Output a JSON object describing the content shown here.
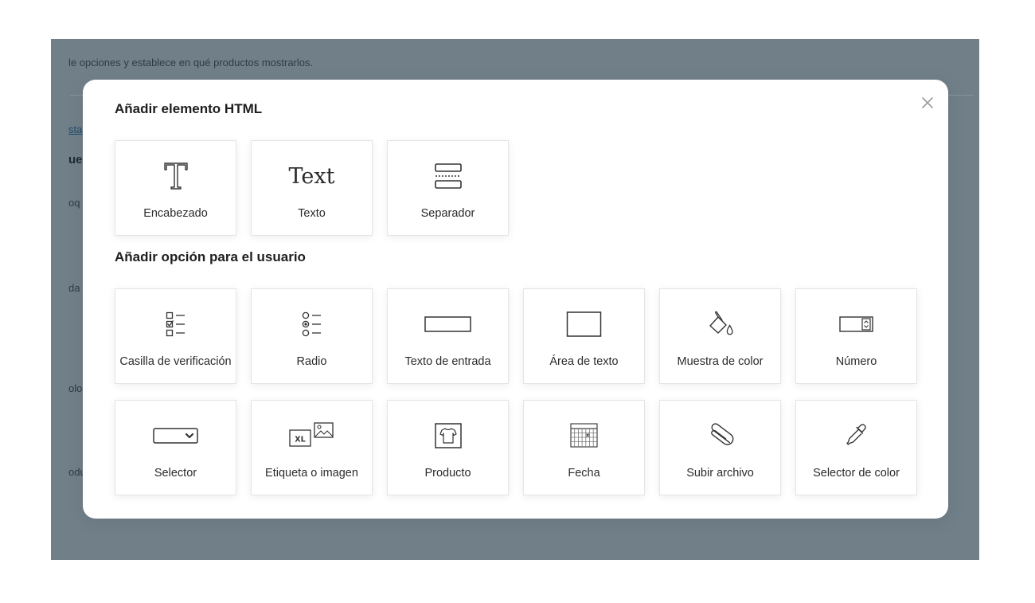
{
  "background": {
    "line1": "le opciones y establece en qué productos mostrarlos.",
    "link": "sta",
    "heading": "ue",
    "frag1": "oq",
    "frag2": "da",
    "frag3": "olo",
    "frag4": "odu"
  },
  "modal": {
    "close_icon": "close-icon",
    "html_section_title": "Añadir elemento HTML",
    "user_section_title": "Añadir opción para el usuario",
    "html_elements": [
      {
        "label": "Encabezado",
        "icon": "heading-icon"
      },
      {
        "label": "Texto",
        "icon": "text-icon",
        "glyph": "Text"
      },
      {
        "label": "Separador",
        "icon": "separator-icon"
      }
    ],
    "user_options": [
      {
        "label": "Casilla de verificación",
        "icon": "checkbox-list-icon"
      },
      {
        "label": "Radio",
        "icon": "radio-list-icon"
      },
      {
        "label": "Texto de entrada",
        "icon": "input-field-icon"
      },
      {
        "label": "Área de texto",
        "icon": "textarea-icon"
      },
      {
        "label": "Muestra de color",
        "icon": "paint-bucket-icon"
      },
      {
        "label": "Número",
        "icon": "number-stepper-icon"
      },
      {
        "label": "Selector",
        "icon": "dropdown-select-icon"
      },
      {
        "label": "Etiqueta o imagen",
        "icon": "label-image-icon",
        "glyph": "XL"
      },
      {
        "label": "Producto",
        "icon": "tshirt-icon"
      },
      {
        "label": "Fecha",
        "icon": "calendar-icon"
      },
      {
        "label": "Subir archivo",
        "icon": "paperclip-icon"
      },
      {
        "label": "Selector de color",
        "icon": "eyedropper-icon"
      }
    ]
  }
}
